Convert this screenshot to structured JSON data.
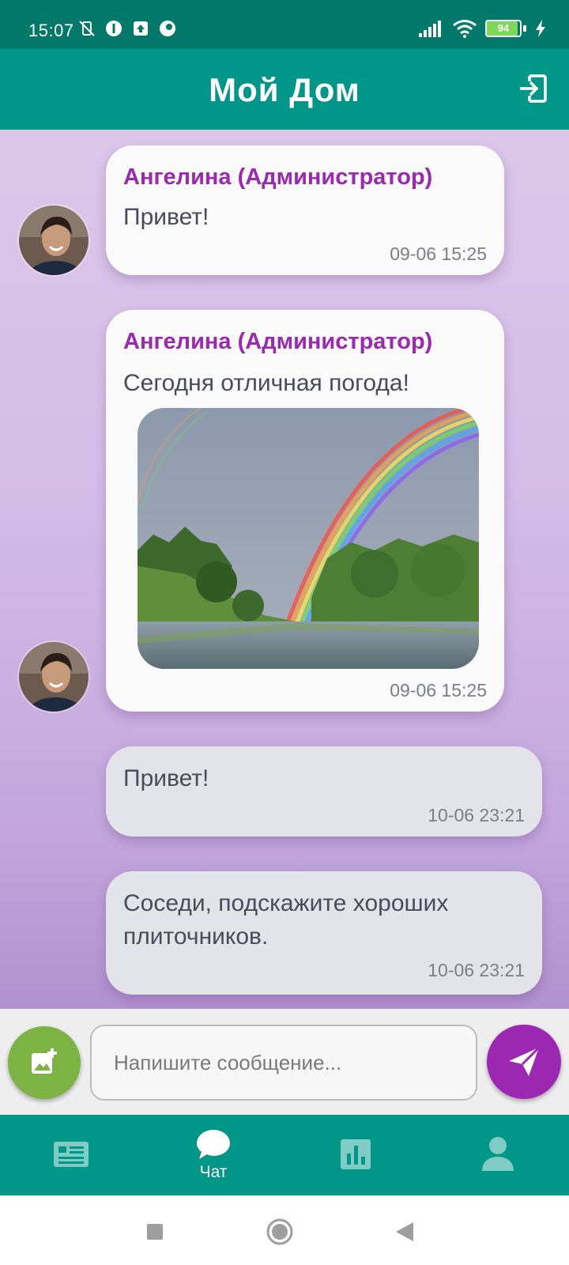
{
  "status_bar": {
    "time": "15:07",
    "battery": "94",
    "battery_level": 0.94
  },
  "app_bar": {
    "title": "Мой Дом",
    "logout_icon": "logout-icon"
  },
  "messages": [
    {
      "sender": "Ангелина (Администратор)",
      "text": "Привет!",
      "time": "09-06 15:25",
      "direction": "incoming"
    },
    {
      "sender": "Ангелина (Администратор)",
      "text": "Сегодня отличная погода!",
      "time": "09-06 15:25",
      "direction": "incoming",
      "image": "rainbow-lake-photo"
    },
    {
      "text": "Привет!",
      "time": "10-06 23:21",
      "direction": "outgoing"
    },
    {
      "text_line1": "Соседи, подскажите хороших",
      "text_line2": "плиточников.",
      "time": "10-06 23:21",
      "direction": "outgoing"
    }
  ],
  "input_bar": {
    "placeholder": "Напишите сообщение...",
    "value": "",
    "attach_icon": "add-photo-icon",
    "send_icon": "send-icon"
  },
  "bottom_nav": {
    "items": [
      {
        "icon": "news-icon",
        "label": ""
      },
      {
        "icon": "chat-icon",
        "label": "Чат",
        "active": true
      },
      {
        "icon": "poll-icon",
        "label": ""
      },
      {
        "icon": "profile-icon",
        "label": ""
      }
    ]
  },
  "colors": {
    "status_bar": "#00796b",
    "primary": "#009688",
    "accent": "#9c27b0",
    "attach": "#7cb342",
    "inactive_nav_icon": "#80cbc4"
  }
}
